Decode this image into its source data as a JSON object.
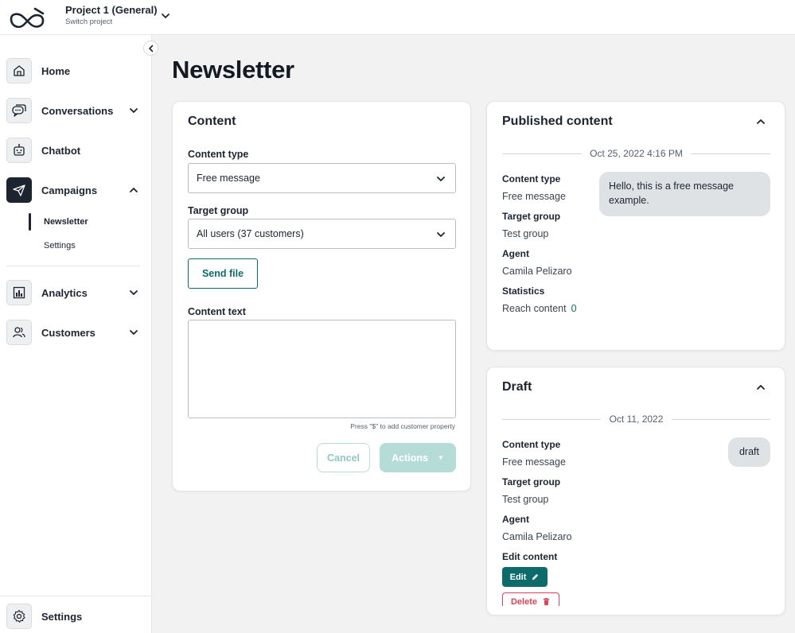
{
  "header": {
    "project_name": "Project 1 (General)",
    "project_sub": "Switch project"
  },
  "sidebar": {
    "items": [
      {
        "label": "Home"
      },
      {
        "label": "Conversations"
      },
      {
        "label": "Chatbot"
      },
      {
        "label": "Campaigns"
      },
      {
        "label": "Analytics"
      },
      {
        "label": "Customers"
      }
    ],
    "campaigns_sub": [
      {
        "label": "Newsletter"
      },
      {
        "label": "Settings"
      }
    ],
    "footer_label": "Settings"
  },
  "page": {
    "title": "Newsletter"
  },
  "content_card": {
    "title": "Content",
    "content_type_label": "Content type",
    "content_type_value": "Free message",
    "target_group_label": "Target group",
    "target_group_value": "All users (37 customers)",
    "send_file_label": "Send file",
    "content_text_label": "Content text",
    "content_text_value": "",
    "hint": "Press \"$\" to add customer property",
    "cancel_label": "Cancel",
    "actions_label": "Actions"
  },
  "published_card": {
    "title": "Published content",
    "date": "Oct 25, 2022 4:16 PM",
    "content_type_label": "Content type",
    "content_type_value": "Free message",
    "target_group_label": "Target group",
    "target_group_value": "Test group",
    "agent_label": "Agent",
    "agent_value": "Camila Pelizaro",
    "statistics_label": "Statistics",
    "reach_label": "Reach content",
    "reach_value": "0",
    "message": "Hello, this is a free message example."
  },
  "draft_card": {
    "title": "Draft",
    "date": "Oct 11, 2022",
    "content_type_label": "Content type",
    "content_type_value": "Free message",
    "target_group_label": "Target group",
    "target_group_value": "Test group",
    "agent_label": "Agent",
    "agent_value": "Camila Pelizaro",
    "edit_content_label": "Edit content",
    "edit_label": "Edit",
    "delete_label": "Delete",
    "message": "draft"
  },
  "colors": {
    "accent": "#0d6b6b",
    "danger": "#d9435a",
    "text": "#1c2430",
    "background": "#f2f2f2"
  },
  "icons": {
    "logo": "infinity-logo-icon",
    "home": "home-icon",
    "conversations": "chat-bubbles-icon",
    "chatbot": "robot-icon",
    "campaigns": "paper-plane-icon",
    "analytics": "bar-chart-icon",
    "customers": "users-icon",
    "settings": "gear-icon"
  }
}
